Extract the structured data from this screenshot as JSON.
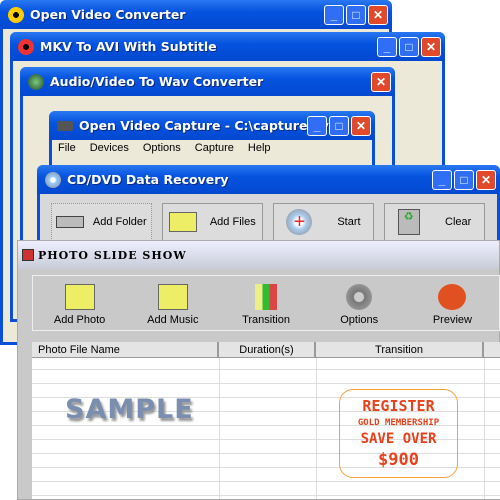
{
  "windows": [
    {
      "title": "Open Video Converter"
    },
    {
      "title": "MKV To AVI With Subtitle"
    },
    {
      "title": "Audio/Video To Wav Converter"
    },
    {
      "title": "Open Video Capture - C:\\capture.avi",
      "menu": [
        "File",
        "Devices",
        "Options",
        "Capture",
        "Help"
      ]
    },
    {
      "title": "CD/DVD Data Recovery",
      "buttons": [
        "Add Folder",
        "Add Files",
        "Start",
        "Clear"
      ]
    }
  ],
  "slideshow": {
    "title": "PHOTO SLIDE SHOW",
    "toolbar": [
      "Add Photo",
      "Add Music",
      "Transition",
      "Options",
      "Preview"
    ],
    "columns": [
      "Photo File Name",
      "Duration(s)",
      "Transition"
    ],
    "watermark": "SAMPLE",
    "promo": [
      "REGISTER",
      "GOLD MEMBERSHIP",
      "SAVE OVER",
      "$900"
    ]
  },
  "controls": {
    "min": "_",
    "max": "□",
    "close": "✕"
  }
}
